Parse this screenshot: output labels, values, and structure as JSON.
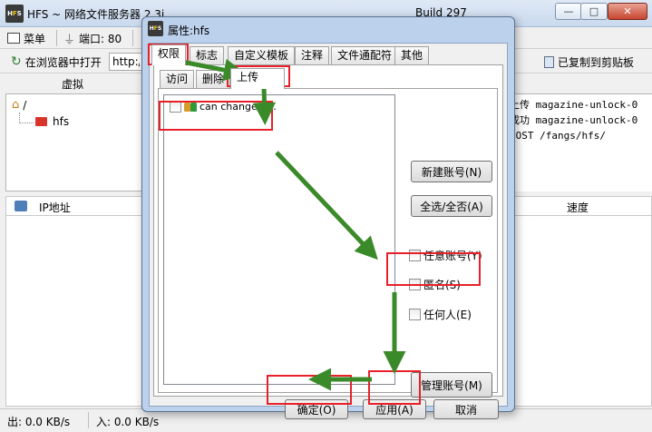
{
  "main_window": {
    "title": "HFS ~ 网络文件服务器 2.3i",
    "build": "Build 297",
    "toolbar": {
      "menu_label": "菜单",
      "port_label": "端口: 80"
    },
    "open_in_browser_label": "在浏览器中打开",
    "url_value": "http:/",
    "copied_label": "已复制到剪贴板",
    "vfs_header": "虚拟",
    "tree_root": "/",
    "tree_child": "hfs",
    "log_lines": [
      "上传 magazine-unlock-0",
      "成功 magazine-unlock-0",
      "POST /fangs/hfs/"
    ],
    "conn_columns": {
      "ip": "IP地址",
      "speed": "速度"
    },
    "status": {
      "out": "出: 0.0 KB/s",
      "in": "入: 0.0 KB/s"
    }
  },
  "dialog": {
    "title": "属性:hfs",
    "tabs": [
      "权限",
      "标志",
      "自定义模板",
      "注释",
      "文件通配符",
      "其他"
    ],
    "subtabs": [
      "访问",
      "删除",
      "上传"
    ],
    "account_item": "can change p...",
    "buttons": {
      "new_account": "新建账号(N)",
      "select_all": "全选/全否(A)",
      "manage_accounts": "管理账号(M)",
      "ok": "确定(O)",
      "apply": "应用(A)",
      "cancel": "取消"
    },
    "checkboxes": {
      "any_account": "任意账号(Y)",
      "anonymous": "匿名(S)",
      "anyone": "任何人(E)"
    }
  },
  "colors": {
    "annotation_red": "#e8202a",
    "annotation_green": "#3b8a2a"
  }
}
